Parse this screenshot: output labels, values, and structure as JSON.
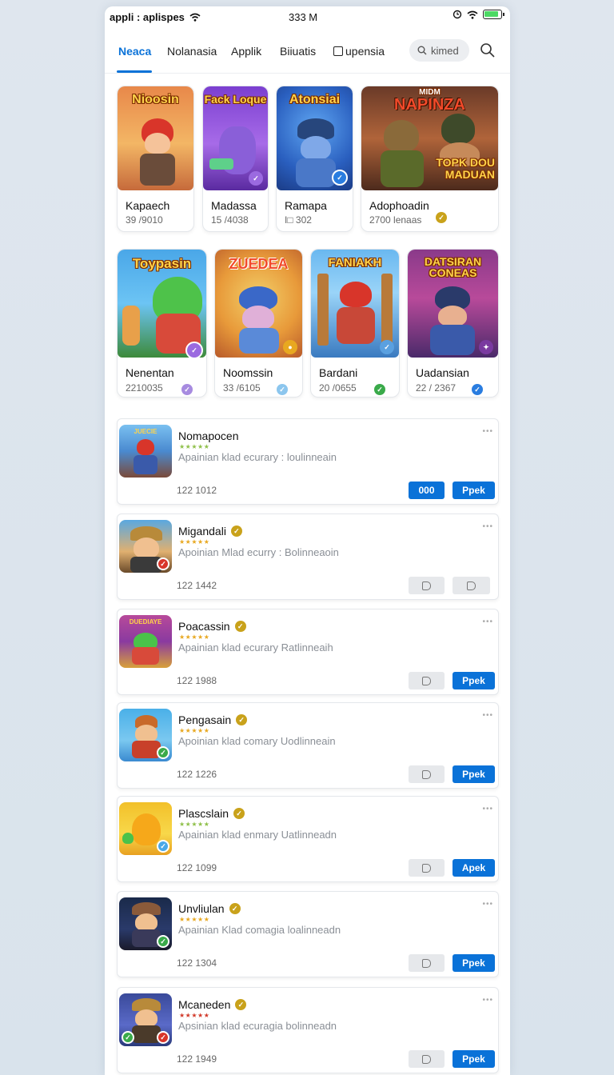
{
  "status_bar": {
    "carrier": "appli : aplispes",
    "time": "333 M",
    "icons": [
      "wifi-icon",
      "alarm-icon",
      "wifi-icon",
      "battery-icon"
    ]
  },
  "tabs": [
    {
      "label": "Neaca",
      "active": true
    },
    {
      "label": "Nolanasia",
      "active": false
    },
    {
      "label": "Applik",
      "active": false
    },
    {
      "label": "Biiuatis",
      "active": false
    },
    {
      "label": "upensia",
      "active": false
    }
  ],
  "search": {
    "placeholder": "kimed"
  },
  "featured_row1": [
    {
      "art_title": "Nioosin",
      "name": "Kapaech",
      "count": "39 /9010"
    },
    {
      "art_title": "Fack Loque",
      "name": "Madassa",
      "count": "15 /4038"
    },
    {
      "art_title": "Atonsiai",
      "name": "Ramapa",
      "count": "I□ 302"
    },
    {
      "art_title": "NAPINZA",
      "art_subtitle": "TOPK DOU MADUAN",
      "art_top": "MIDM",
      "name": "Adophoadin",
      "count": "2700 lenaas"
    }
  ],
  "featured_row2": [
    {
      "art_title": "Toypasin",
      "name": "Nenentan",
      "count": "2210035"
    },
    {
      "art_title": "ZUEDEA",
      "name": "Noomssin",
      "count": "33 /6105"
    },
    {
      "art_title": "FANIAKH",
      "name": "Bardani",
      "count": "20 /0655"
    },
    {
      "art_title": "DATSIRAN CONEAS",
      "name": "Uadansian",
      "count": "22 / 2367"
    }
  ],
  "list": [
    {
      "title": "Nomapocen",
      "verified": false,
      "desc": "Apainian klad ecurary : loulinneain",
      "meta": "122 1012",
      "btn1": "000",
      "btn1_style": "primary",
      "btn2": "Ppek",
      "btn2_style": "primary",
      "thumb_art": "JUECIE"
    },
    {
      "title": "Migandali",
      "verified": true,
      "desc": "Apoinian Mlad ecurry : Bolinneaoin",
      "meta": "122 1442",
      "btn1": "",
      "btn1_style": "ghost",
      "btn2": "",
      "btn2_style": "ghost",
      "thumb_art": ""
    },
    {
      "title": "Poacassin",
      "verified": true,
      "desc": "Apainian klad ecurary Ratlinneaih",
      "meta": "122 1988",
      "btn1": "",
      "btn1_style": "ghost",
      "btn2": "Ppek",
      "btn2_style": "primary",
      "thumb_art": "DUEDIAYE"
    },
    {
      "title": "Pengasain",
      "verified": true,
      "desc": "Apoinian klad comary Uodlinneain",
      "meta": "122 1226",
      "btn1": "",
      "btn1_style": "ghost",
      "btn2": "Ppek",
      "btn2_style": "primary",
      "thumb_art": ""
    },
    {
      "title": "Plascslain",
      "verified": true,
      "desc": "Apainian klad enmary Uatlinneadn",
      "meta": "122 1099",
      "btn1": "",
      "btn1_style": "ghost",
      "btn2": "Apek",
      "btn2_style": "primary",
      "thumb_art": ""
    },
    {
      "title": "Unvliulan",
      "verified": true,
      "desc": "Apainian Klad comagia loalinneadn",
      "meta": "122 1304",
      "btn1": "",
      "btn1_style": "ghost",
      "btn2": "Ppek",
      "btn2_style": "primary",
      "thumb_art": ""
    },
    {
      "title": "Mcaneden",
      "verified": true,
      "desc": "Apsinian klad ecuragia bolinneadn",
      "meta": "122 1949",
      "btn1": "",
      "btn1_style": "ghost",
      "btn2": "Ppek",
      "btn2_style": "primary",
      "thumb_art": ""
    }
  ],
  "more_glyph": "•••",
  "colors": {
    "accent": "#0a72d8",
    "verified": "#c9a21b",
    "star_gold": "#e8a820",
    "star_green": "#8fc04a",
    "star_red": "#d23a2a"
  }
}
